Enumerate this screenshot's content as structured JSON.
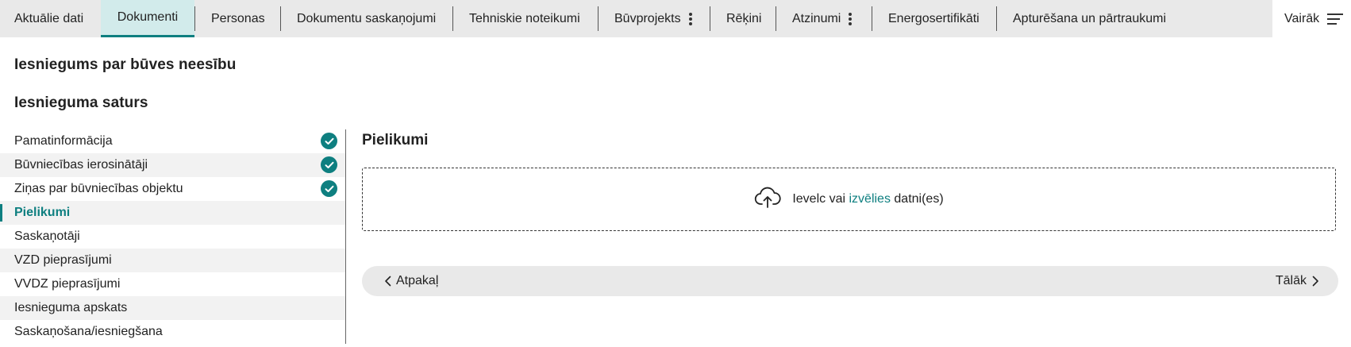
{
  "tabs": [
    {
      "label": "Aktuālie dati"
    },
    {
      "label": "Dokumenti"
    },
    {
      "label": "Personas"
    },
    {
      "label": "Dokumentu saskaņojumi"
    },
    {
      "label": "Tehniskie noteikumi"
    },
    {
      "label": "Būvprojekts"
    },
    {
      "label": "Rēķini"
    },
    {
      "label": "Atzinumi"
    },
    {
      "label": "Energosertifikāti"
    },
    {
      "label": "Apturēšana un pārtraukumi"
    }
  ],
  "active_tab": "Dokumenti",
  "more_label": "Vairāk",
  "page_title": "Iesniegums par būves neesību",
  "content_title": "Iesnieguma saturs",
  "nav": [
    {
      "label": "Pamatinformācija",
      "status": "complete"
    },
    {
      "label": "Būvniecības ierosinātāji",
      "status": "complete"
    },
    {
      "label": "Ziņas par būvniecības objektu",
      "status": "complete"
    },
    {
      "label": "Pielikumi",
      "status": "current"
    },
    {
      "label": "Saskaņotāji"
    },
    {
      "label": "VZD pieprasījumi"
    },
    {
      "label": "VVDZ pieprasījumi"
    },
    {
      "label": "Iesnieguma apskats"
    },
    {
      "label": "Saskaņošana/iesniegšana"
    }
  ],
  "section_title": "Pielikumi",
  "upload": {
    "prefix": "Ievelc vai",
    "link": "izvēlies",
    "suffix": "datni(es)",
    "icon": "cloud-upload-icon"
  },
  "buttons": {
    "back": "Atpakaļ",
    "next": "Tālāk"
  },
  "colors": {
    "accent": "#0e7f80",
    "active_tab_bg": "#d2ebeb",
    "bar_bg": "#e9e9e9"
  }
}
